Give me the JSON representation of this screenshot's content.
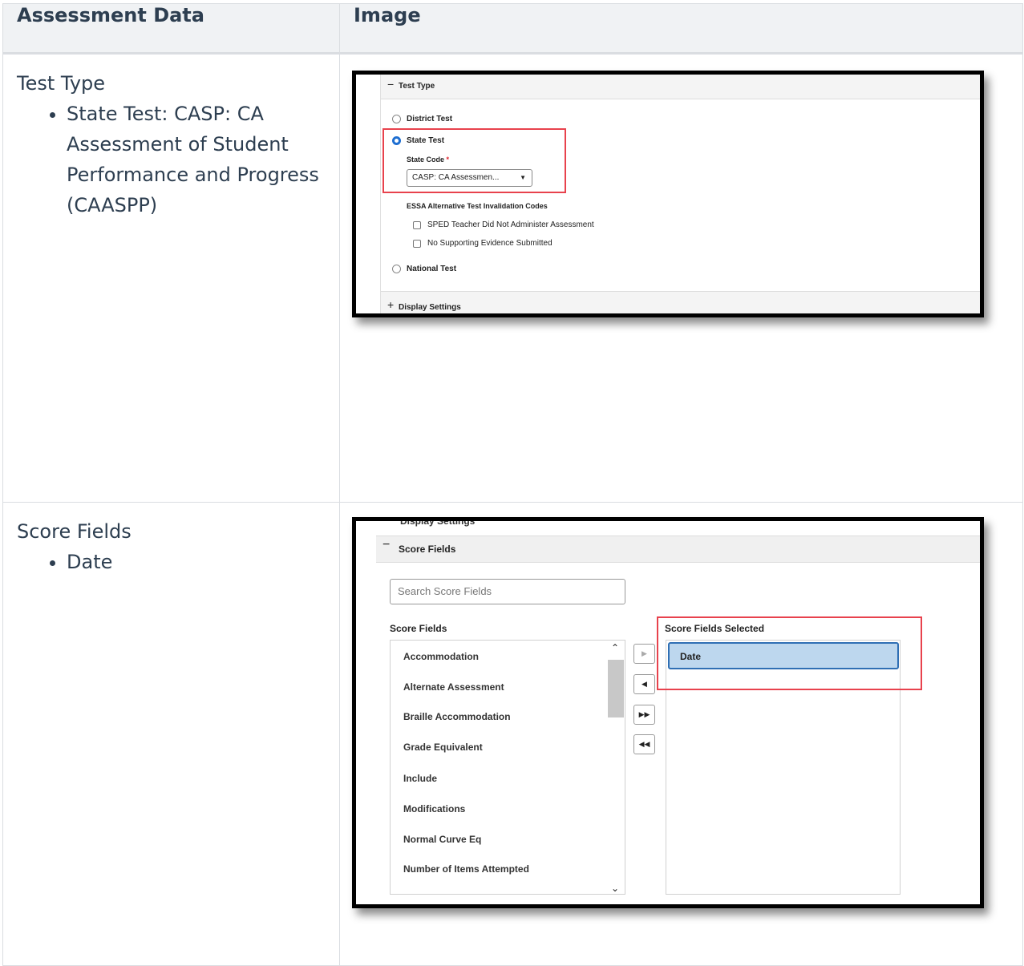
{
  "table": {
    "headers": [
      "Assessment Data",
      "Image"
    ],
    "rows": [
      {
        "title": "Test Type",
        "bullets": [
          "State Test: CASP: CA Assessment of Student Performance and Progress (CAASPP)"
        ]
      },
      {
        "title": "Score Fields",
        "bullets": [
          "Date"
        ]
      }
    ]
  },
  "screenshot1": {
    "section_title": "Test Type",
    "district_test": "District Test",
    "state_test": "State Test",
    "state_code_label": "State Code",
    "required_mark": "*",
    "state_code_value": "CASP: CA Assessmen...",
    "essa_label": "ESSA Alternative Test Invalidation Codes",
    "checkboxes": [
      "SPED Teacher Did Not Administer Assessment",
      "No Supporting Evidence Submitted"
    ],
    "national_test": "National Test",
    "display_settings": "Display Settings",
    "highlight_color": "#e8424d"
  },
  "screenshot2": {
    "cut_title": "Display Settings",
    "section_title": "Score Fields",
    "search_placeholder": "Search Score Fields",
    "available_label": "Score Fields",
    "selected_label": "Score Fields Selected",
    "available_items": [
      "Accommodation",
      "Alternate Assessment",
      "Braille Accommodation",
      "Grade Equivalent",
      "Include",
      "Modifications",
      "Normal Curve Eq",
      "Number of Items Attempted"
    ],
    "selected_items": [
      "Date"
    ],
    "buttons": [
      "▶",
      "◀",
      "▶▶",
      "◀◀"
    ]
  }
}
